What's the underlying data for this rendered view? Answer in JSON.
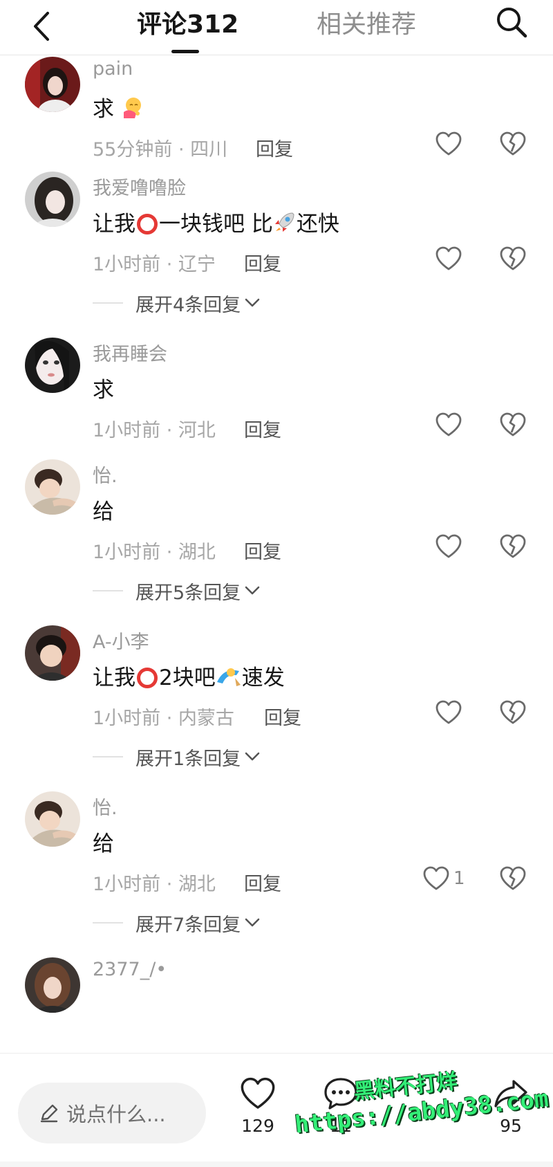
{
  "header": {
    "tab_comments": "评论312",
    "tab_related": "相关推荐"
  },
  "comments": [
    {
      "username": "pain",
      "text": "求",
      "time_location": "55分钟前 · 四川",
      "reply": "回复"
    },
    {
      "username": "我爱噜噜脸",
      "text_a": "让我",
      "text_b": "一块钱吧 比",
      "text_c": "还快",
      "time_location": "1小时前 · 辽宁",
      "reply": "回复",
      "expand": "展开4条回复"
    },
    {
      "username": "我再睡会",
      "text": "求",
      "time_location": "1小时前 · 河北",
      "reply": "回复"
    },
    {
      "username": "怡.",
      "text": "给",
      "time_location": "1小时前 · 湖北",
      "reply": "回复",
      "expand": "展开5条回复"
    },
    {
      "username": "A-小李",
      "text_a": "让我",
      "text_b": "2块吧",
      "text_c": "速发",
      "time_location": "1小时前 · 内蒙古",
      "reply": "回复",
      "expand": "展开1条回复"
    },
    {
      "username": "怡.",
      "text": "给",
      "time_location": "1小时前 · 湖北",
      "reply": "回复",
      "like_count": "1",
      "expand": "展开7条回复"
    },
    {
      "username": "2377_/•"
    }
  ],
  "bottom_bar": {
    "input_placeholder": "说点什么...",
    "like_count": "129",
    "comment_count": "11",
    "share_count": "95"
  },
  "watermark": {
    "line1": "黑料不打烊",
    "line2": "https://abdy38.com"
  },
  "colors": {
    "accent_red": "#e53935",
    "watermark_green": "#33ee77",
    "muted_text": "#a6a6a6"
  },
  "icons": [
    "back-arrow-icon",
    "search-icon",
    "heart-icon",
    "broken-heart-icon",
    "chevron-down-icon",
    "pencil-icon",
    "comment-bubble-icon",
    "share-arrow-icon"
  ]
}
